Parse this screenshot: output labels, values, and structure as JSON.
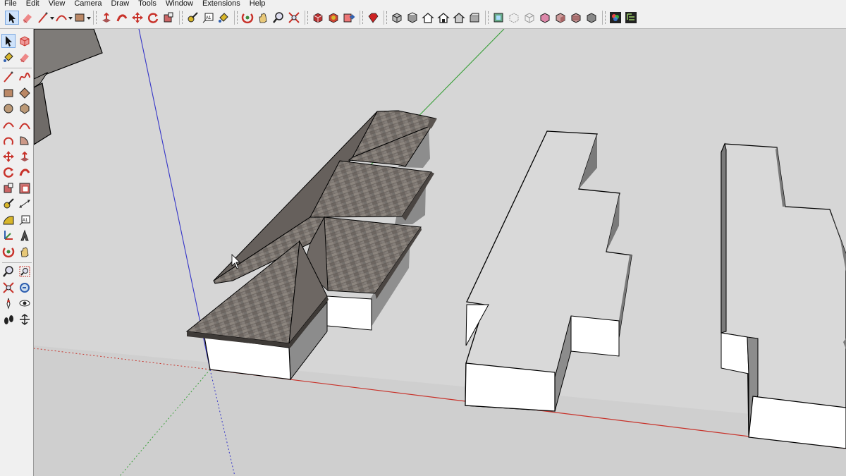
{
  "menu": [
    "File",
    "Edit",
    "View",
    "Camera",
    "Draw",
    "Tools",
    "Window",
    "Extensions",
    "Help"
  ],
  "top_toolbar": [
    {
      "name": "select-icon",
      "selected": true
    },
    {
      "name": "eraser-icon"
    },
    {
      "name": "line-icon",
      "dropdown": true
    },
    {
      "name": "arc-icon",
      "dropdown": true
    },
    {
      "name": "rectangle-icon",
      "dropdown": true
    },
    {
      "name": "push-pull-icon"
    },
    {
      "name": "follow-me-icon"
    },
    {
      "name": "move-icon"
    },
    {
      "name": "rotate-icon"
    },
    {
      "name": "scale-icon"
    },
    {
      "name": "tape-measure-icon"
    },
    {
      "name": "text-icon"
    },
    {
      "name": "paint-bucket-icon"
    },
    {
      "name": "orbit-icon"
    },
    {
      "name": "pan-icon"
    },
    {
      "name": "zoom-icon"
    },
    {
      "name": "zoom-extents-icon"
    },
    {
      "name": "3d-warehouse-icon"
    },
    {
      "name": "extension-warehouse-icon"
    },
    {
      "name": "send-to-layout-icon"
    },
    {
      "name": "ruby-extension-icon"
    },
    {
      "name": "iso-view-icon"
    },
    {
      "name": "top-view-icon"
    },
    {
      "name": "front-view-icon"
    },
    {
      "name": "right-view-icon"
    },
    {
      "name": "back-view-icon"
    },
    {
      "name": "left-view-icon"
    },
    {
      "name": "xray-style-icon"
    },
    {
      "name": "back-edges-style-icon"
    },
    {
      "name": "wireframe-style-icon"
    },
    {
      "name": "hidden-line-style-icon"
    },
    {
      "name": "shaded-style-icon"
    },
    {
      "name": "shaded-textures-style-icon"
    },
    {
      "name": "monochrome-style-icon"
    },
    {
      "name": "default-tray-icon"
    },
    {
      "name": "outliner-icon"
    }
  ],
  "left_toolbar": [
    {
      "name": "select-icon",
      "selected": true
    },
    {
      "name": "make-component-icon"
    },
    {
      "name": "paint-bucket-icon"
    },
    {
      "name": "eraser-icon"
    },
    {
      "name": "line-icon"
    },
    {
      "name": "freehand-icon"
    },
    {
      "name": "rectangle-icon"
    },
    {
      "name": "rotated-rectangle-icon"
    },
    {
      "name": "circle-icon"
    },
    {
      "name": "polygon-icon"
    },
    {
      "name": "arc-icon"
    },
    {
      "name": "two-point-arc-icon"
    },
    {
      "name": "three-point-arc-icon"
    },
    {
      "name": "pie-icon"
    },
    {
      "name": "move-icon"
    },
    {
      "name": "push-pull-icon"
    },
    {
      "name": "rotate-icon"
    },
    {
      "name": "follow-me-icon"
    },
    {
      "name": "scale-icon"
    },
    {
      "name": "offset-icon"
    },
    {
      "name": "tape-measure-icon"
    },
    {
      "name": "dimension-icon"
    },
    {
      "name": "protractor-icon"
    },
    {
      "name": "text-icon"
    },
    {
      "name": "axes-icon"
    },
    {
      "name": "3d-text-icon"
    },
    {
      "name": "orbit-icon"
    },
    {
      "name": "pan-icon"
    },
    {
      "name": "zoom-icon"
    },
    {
      "name": "zoom-window-icon"
    },
    {
      "name": "zoom-extents-icon"
    },
    {
      "name": "previous-view-icon"
    },
    {
      "name": "position-camera-icon"
    },
    {
      "name": "look-around-icon"
    },
    {
      "name": "walk-icon"
    },
    {
      "name": "section-plane-icon"
    }
  ],
  "colors": {
    "chrome": "#f0f0f0",
    "background": "#d6d6d6",
    "axis_red": "#c8322a",
    "axis_green": "#3aa03a",
    "axis_blue": "#3535c8",
    "roof": "#7a736e",
    "wall": "#ffffff"
  }
}
